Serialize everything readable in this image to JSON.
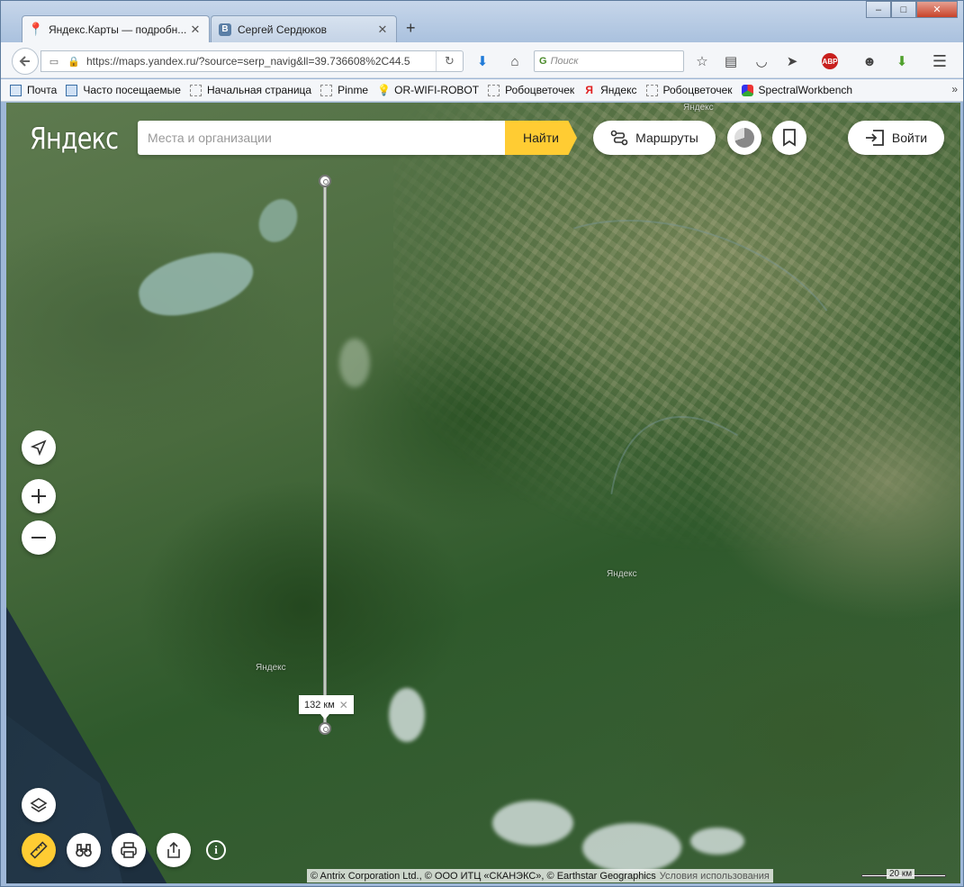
{
  "browser": {
    "tabs": [
      {
        "title": "Яндекс.Карты — подробн...",
        "active": true,
        "icon": "map-pin-icon"
      },
      {
        "title": "Сергей Сердюков",
        "active": false,
        "icon": "vk-icon"
      }
    ],
    "new_tab": "+",
    "window_controls": {
      "minimize": "–",
      "maximize": "□",
      "close": "✕"
    },
    "url": "https://maps.yandex.ru/?source=serp_navig&ll=39.736608%2C44.5",
    "search_placeholder": "Поиск",
    "bookmarks": [
      {
        "label": "Почта",
        "icon": "mail-icon"
      },
      {
        "label": "Часто посещаемые",
        "icon": "folder-icon"
      },
      {
        "label": "Начальная страница",
        "icon": "page-icon"
      },
      {
        "label": "Pinme",
        "icon": "page-icon"
      },
      {
        "label": "OR-WIFI-ROBOT",
        "icon": "bulb-icon"
      },
      {
        "label": "Робоцветочек",
        "icon": "page-icon"
      },
      {
        "label": "Яндекс",
        "icon": "yandex-icon"
      },
      {
        "label": "Робоцветочек",
        "icon": "page-icon"
      },
      {
        "label": "SpectralWorkbench",
        "icon": "cube-icon"
      }
    ],
    "bookmarks_more": "»"
  },
  "map": {
    "logo": "Яндекс",
    "search_placeholder": "Места и организации",
    "find_button": "Найти",
    "routes_button": "Маршруты",
    "login_button": "Войти",
    "labels": [
      "Яндекс",
      "Яндекс",
      "Яндекс"
    ],
    "ruler_distance": "132 км",
    "copyright": "© Antrix Corporation Ltd., © ООО ИТЦ «СКАНЭКС», © Earthstar Geographics",
    "terms": "Условия использования",
    "scale_label": "20 км",
    "colors": {
      "accent": "#ffcc33",
      "ruler_active": "#ffcc33"
    }
  }
}
